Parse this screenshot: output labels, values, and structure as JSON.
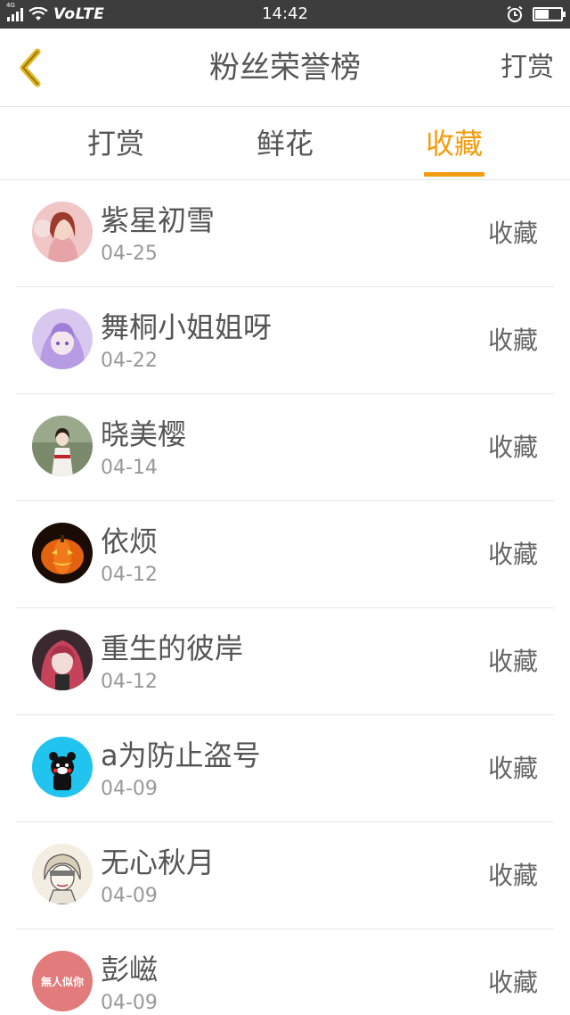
{
  "status_bar": {
    "network": "4G",
    "carrier": "VoLTE",
    "time": "14:42",
    "battery_level": 0.5
  },
  "header": {
    "back_icon": "chevron-left-icon",
    "title": "粉丝荣誉榜",
    "action_label": "打赏"
  },
  "tabs": [
    {
      "label": "打赏",
      "active": false
    },
    {
      "label": "鲜花",
      "active": false
    },
    {
      "label": "收藏",
      "active": true
    }
  ],
  "colors": {
    "accent": "#f39c0f",
    "text": "#555555",
    "subtext": "#999999",
    "divider": "#e6e6e6",
    "status_bar": "#3d3d3d"
  },
  "fans": [
    {
      "name": "紫星初雪",
      "date": "04-25",
      "action": "收藏"
    },
    {
      "name": "舞桐小姐姐呀",
      "date": "04-22",
      "action": "收藏"
    },
    {
      "name": "晓美樱",
      "date": "04-14",
      "action": "收藏"
    },
    {
      "name": "依烦",
      "date": "04-12",
      "action": "收藏"
    },
    {
      "name": "重生的彼岸",
      "date": "04-12",
      "action": "收藏"
    },
    {
      "name": "a为防止盗号",
      "date": "04-09",
      "action": "收藏"
    },
    {
      "name": "无心秋月",
      "date": "04-09",
      "action": "收藏"
    },
    {
      "name": "彭嵫",
      "date": "04-09",
      "action": "收藏",
      "avatar_text": "無人似你"
    }
  ]
}
